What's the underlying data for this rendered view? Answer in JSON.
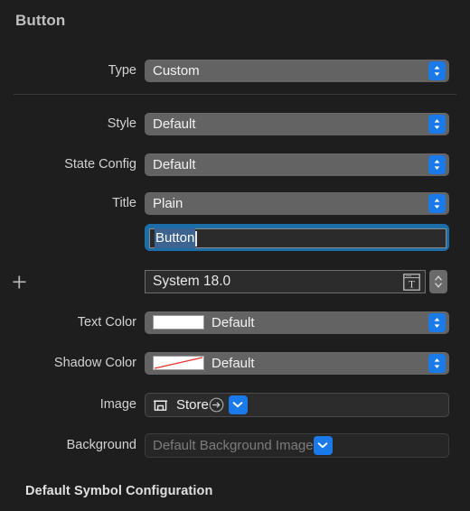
{
  "panel": {
    "section_title": "Button",
    "footer_title": "Default Symbol Configuration",
    "accent_color": "#1a7aea",
    "background_color": "#1e1e1e",
    "popup_color": "#636363",
    "focus_ring_color": "#1b6ea8",
    "selection_color": "#3d6390"
  },
  "rows": {
    "type": {
      "label": "Type",
      "value": "Custom"
    },
    "style": {
      "label": "Style",
      "value": "Default"
    },
    "state_config": {
      "label": "State Config",
      "value": "Default"
    },
    "title": {
      "label": "Title",
      "value": "Plain"
    },
    "title_text": {
      "value": "Button"
    },
    "font": {
      "value": "System 18.0",
      "add_label": "+"
    },
    "text_color": {
      "label": "Text Color",
      "value": "Default",
      "swatch": "#ffffff"
    },
    "shadow_color": {
      "label": "Shadow Color",
      "value": "Default",
      "swatch": "#ffffff",
      "strike": "#e8342a"
    },
    "image": {
      "label": "Image",
      "value": "Store"
    },
    "background": {
      "label": "Background",
      "placeholder": "Default Background Image"
    }
  },
  "icons": {
    "popup_stepper": "updown-chevron-icon",
    "font_picker": "font-panel-icon",
    "number_stepper": "stepper-icon",
    "store": "store-icon",
    "reveal": "arrow-right-circle-icon",
    "image_menu": "chevron-down-icon",
    "background_menu": "chevron-down-icon",
    "add": "plus-icon"
  }
}
